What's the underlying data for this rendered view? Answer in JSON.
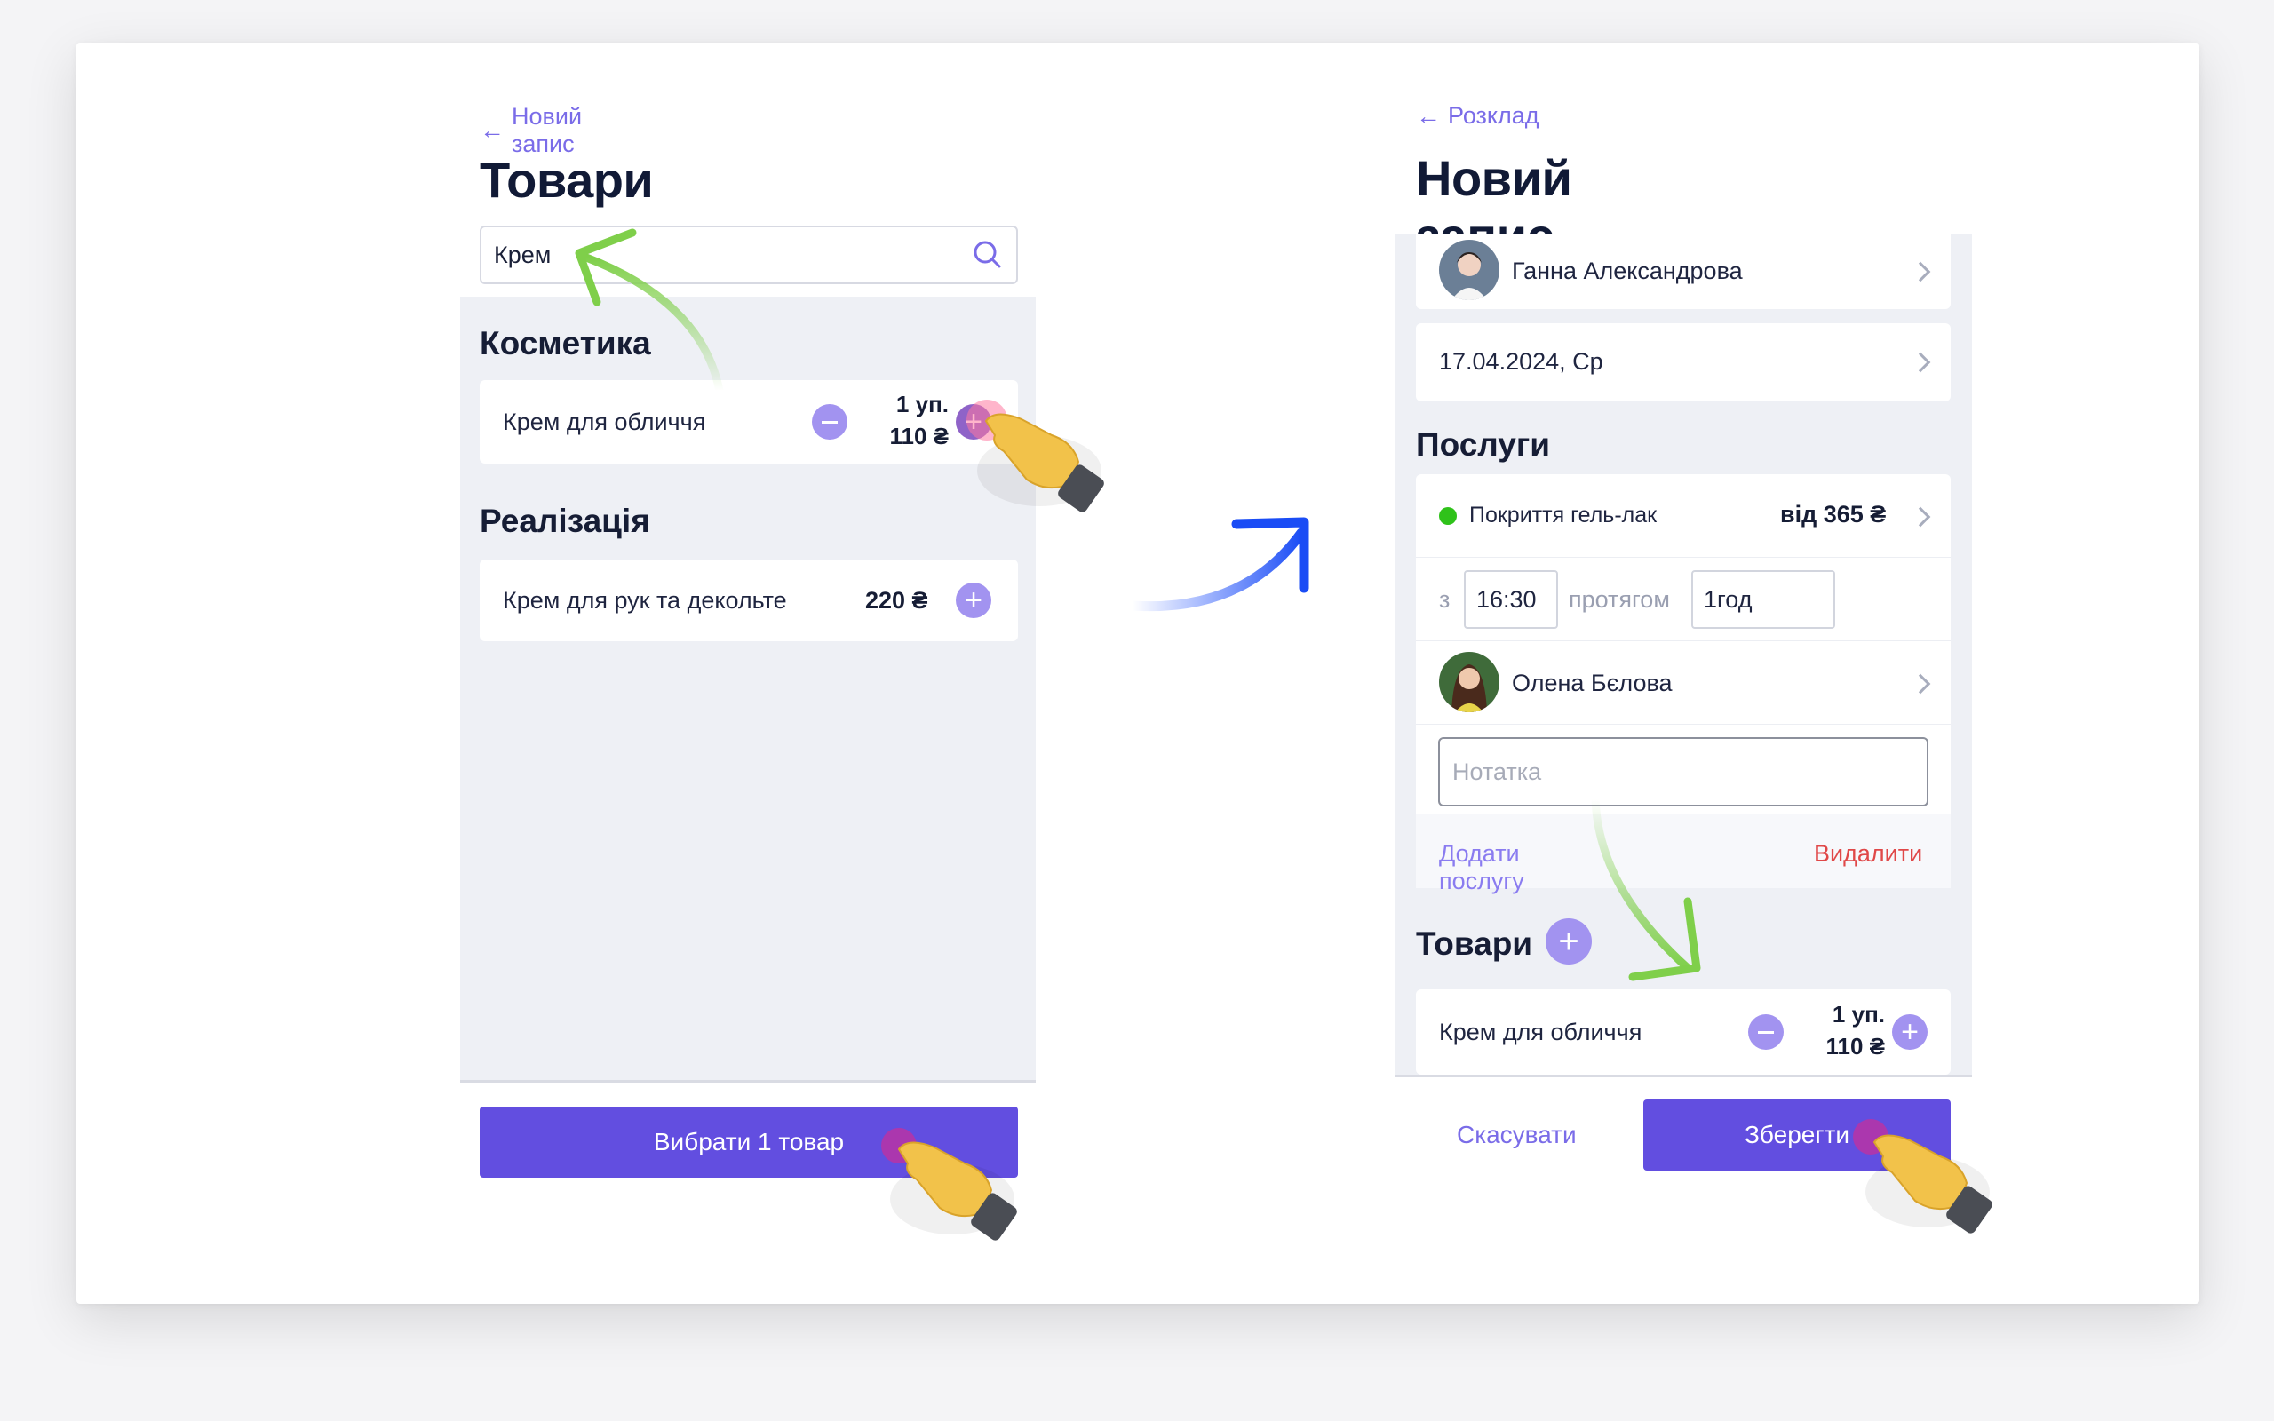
{
  "left_screen": {
    "back_label": "Новий запис",
    "title": "Товари",
    "search": {
      "value": "Крем",
      "placeholder": ""
    },
    "sections": [
      {
        "title": "Косметика",
        "items": [
          {
            "name": "Крем для обличчя",
            "qty": "1 уп.",
            "price": "110 ₴"
          }
        ]
      },
      {
        "title": "Реалізація",
        "items": [
          {
            "name": "Крем для рук та декольте",
            "price": "220 ₴"
          }
        ]
      }
    ],
    "select_button": "Вибрати 1 товар"
  },
  "right_screen": {
    "back_label": "Розклад",
    "title": "Новий запис",
    "client": "Ганна  Александрова",
    "date": "17.04.2024, Ср",
    "services_title": "Послуги",
    "service": {
      "name": "Покриття гель-лак",
      "price": "від 365 ₴",
      "status_color": "#2fc21a"
    },
    "from_label": "з",
    "time_from": "16:30",
    "duration_label": "протягом",
    "duration": "1год",
    "master": "Олена Бєлова",
    "note_placeholder": "Нотатка",
    "add_service": "Додати послугу",
    "delete": "Видалити",
    "products_title": "Товари",
    "product": {
      "name": "Крем для обличчя",
      "qty": "1 уп.",
      "price": "110 ₴"
    },
    "cancel": "Скасувати",
    "save": "Зберегти"
  },
  "colors": {
    "primary": "#624ee0",
    "accent_light": "#a293f0",
    "link": "#7a6ce8",
    "danger": "#e04848",
    "panel_bg": "#eef0f5"
  },
  "icons": [
    "back-arrow-icon",
    "search-icon",
    "minus-icon",
    "plus-icon",
    "chevron-right-icon",
    "pointing-hand-icon"
  ]
}
